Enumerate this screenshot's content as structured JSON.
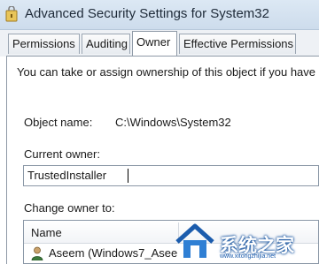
{
  "window": {
    "title": "Advanced Security Settings for System32",
    "icon": "folder-lock-icon"
  },
  "tabs": [
    {
      "label": "Permissions",
      "active": false
    },
    {
      "label": "Auditing",
      "active": false
    },
    {
      "label": "Owner",
      "active": true
    },
    {
      "label": "Effective Permissions",
      "active": false
    }
  ],
  "owner_tab": {
    "info_text": "You can take or assign ownership of this object if you have",
    "object_name_label": "Object name:",
    "object_name_value": "C:\\Windows\\System32",
    "current_owner_label": "Current owner:",
    "current_owner_value": "TrustedInstaller",
    "change_owner_label": "Change owner to:",
    "list": {
      "column_name": "Name",
      "rows": [
        {
          "text": "Aseem (Windows7_Asee",
          "icon": "user-icon"
        }
      ]
    }
  },
  "watermark": {
    "text": "系统之家",
    "url": "www.xitongzhijia.net"
  },
  "colors": {
    "titlebar": "#cddcec",
    "accent_blue": "#1b5cad"
  }
}
